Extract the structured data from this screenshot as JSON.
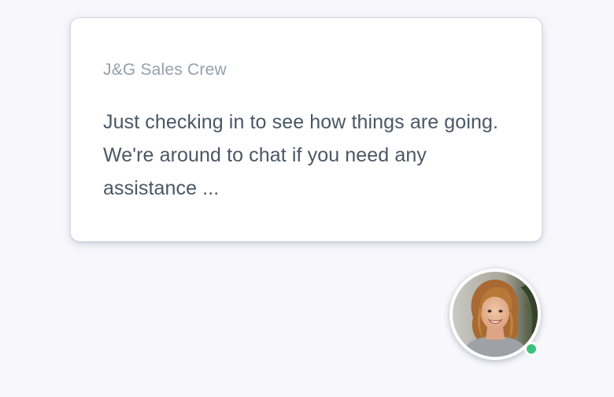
{
  "chat": {
    "sender": "J&G Sales Crew",
    "message": "Just checking in to see how things are going. We're around to chat if you need any assistance ..."
  },
  "avatar": {
    "icon": "agent-avatar-photo",
    "status": "online"
  },
  "colors": {
    "page_background": "#f7f7fc",
    "card_background": "#ffffff",
    "sender_text": "#95a0ad",
    "message_text": "#4a5766",
    "status_online": "#3cc27a"
  }
}
